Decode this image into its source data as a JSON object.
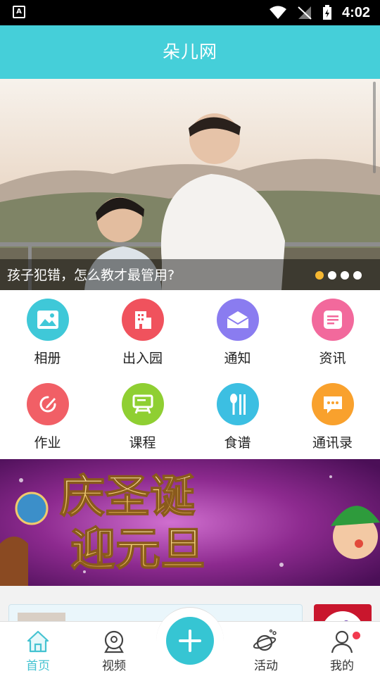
{
  "status_bar": {
    "time": "4:02",
    "left_icon": "A"
  },
  "header": {
    "title": "朵儿网"
  },
  "banner": {
    "caption": "孩子犯错，怎么教才最管用?",
    "dots_total": 4,
    "active_dot": 1
  },
  "features": [
    {
      "label": "相册",
      "icon": "photo-icon",
      "color": "#3fc8d8"
    },
    {
      "label": "出入园",
      "icon": "building-icon",
      "color": "#f0525d"
    },
    {
      "label": "通知",
      "icon": "mail-icon",
      "color": "#8a7cf0"
    },
    {
      "label": "资讯",
      "icon": "document-icon",
      "color": "#f2699c"
    },
    {
      "label": "作业",
      "icon": "edit-icon",
      "color": "#f15f66"
    },
    {
      "label": "课程",
      "icon": "board-icon",
      "color": "#8fcf32"
    },
    {
      "label": "食谱",
      "icon": "cutlery-icon",
      "color": "#3cbfe2"
    },
    {
      "label": "通讯录",
      "icon": "chat-icon",
      "color": "#f9a12d"
    }
  ],
  "promo": {
    "text_line1": "庆圣诞",
    "text_line2": "迎元旦"
  },
  "bottom_nav": {
    "home": "首页",
    "video": "视频",
    "activity": "活动",
    "mine": "我的",
    "add": "+"
  },
  "colors": {
    "accent": "#45cfd9",
    "active_dot": "#f5b731",
    "badge": "#f23a4f"
  }
}
